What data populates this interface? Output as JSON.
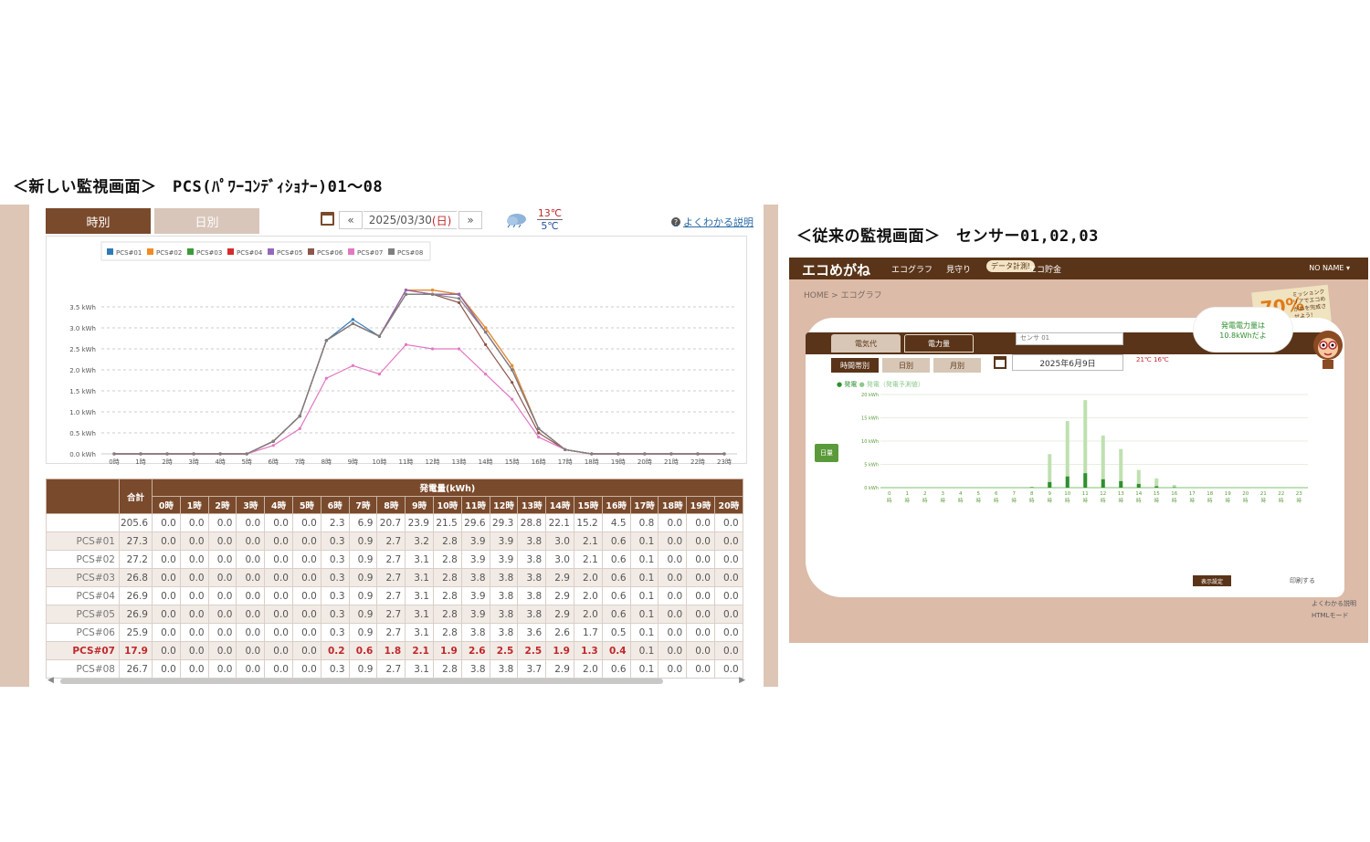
{
  "headings": {
    "new": "＜新しい監視画面＞　PCS(ﾊﾟﾜｰｺﾝﾃﾞｨｼｮﾅｰ)01～08",
    "old": "＜従来の監視画面＞　センサー01,02,03"
  },
  "new_screen": {
    "tabs": {
      "hourly": "時別",
      "daily": "日別"
    },
    "date_nav": {
      "prev": "«",
      "next": "»",
      "date": "2025/03/30",
      "dow": "(日)"
    },
    "weather": {
      "high": "13℃",
      "low": "5℃"
    },
    "help_link": "よくわかる説明",
    "table": {
      "header_total": "合計",
      "header_group": "発電量(kWh)",
      "hours": [
        "0時",
        "1時",
        "2時",
        "3時",
        "4時",
        "5時",
        "6時",
        "7時",
        "8時",
        "9時",
        "10時",
        "11時",
        "12時",
        "13時",
        "14時",
        "15時",
        "16時",
        "17時",
        "18時",
        "19時",
        "20時"
      ],
      "rows": [
        {
          "label": "",
          "total": "205.6",
          "values": [
            "0.0",
            "0.0",
            "0.0",
            "0.0",
            "0.0",
            "0.0",
            "2.3",
            "6.9",
            "20.7",
            "23.9",
            "21.5",
            "29.6",
            "29.3",
            "28.8",
            "22.1",
            "15.2",
            "4.5",
            "0.8",
            "0.0",
            "0.0",
            "0.0"
          ]
        },
        {
          "label": "PCS#01",
          "total": "27.3",
          "values": [
            "0.0",
            "0.0",
            "0.0",
            "0.0",
            "0.0",
            "0.0",
            "0.3",
            "0.9",
            "2.7",
            "3.2",
            "2.8",
            "3.9",
            "3.9",
            "3.8",
            "3.0",
            "2.1",
            "0.6",
            "0.1",
            "0.0",
            "0.0",
            "0.0"
          ]
        },
        {
          "label": "PCS#02",
          "total": "27.2",
          "values": [
            "0.0",
            "0.0",
            "0.0",
            "0.0",
            "0.0",
            "0.0",
            "0.3",
            "0.9",
            "2.7",
            "3.1",
            "2.8",
            "3.9",
            "3.9",
            "3.8",
            "3.0",
            "2.1",
            "0.6",
            "0.1",
            "0.0",
            "0.0",
            "0.0"
          ]
        },
        {
          "label": "PCS#03",
          "total": "26.8",
          "values": [
            "0.0",
            "0.0",
            "0.0",
            "0.0",
            "0.0",
            "0.0",
            "0.3",
            "0.9",
            "2.7",
            "3.1",
            "2.8",
            "3.8",
            "3.8",
            "3.8",
            "2.9",
            "2.0",
            "0.6",
            "0.1",
            "0.0",
            "0.0",
            "0.0"
          ]
        },
        {
          "label": "PCS#04",
          "total": "26.9",
          "values": [
            "0.0",
            "0.0",
            "0.0",
            "0.0",
            "0.0",
            "0.0",
            "0.3",
            "0.9",
            "2.7",
            "3.1",
            "2.8",
            "3.9",
            "3.8",
            "3.8",
            "2.9",
            "2.0",
            "0.6",
            "0.1",
            "0.0",
            "0.0",
            "0.0"
          ]
        },
        {
          "label": "PCS#05",
          "total": "26.9",
          "values": [
            "0.0",
            "0.0",
            "0.0",
            "0.0",
            "0.0",
            "0.0",
            "0.3",
            "0.9",
            "2.7",
            "3.1",
            "2.8",
            "3.9",
            "3.8",
            "3.8",
            "2.9",
            "2.0",
            "0.6",
            "0.1",
            "0.0",
            "0.0",
            "0.0"
          ]
        },
        {
          "label": "PCS#06",
          "total": "25.9",
          "values": [
            "0.0",
            "0.0",
            "0.0",
            "0.0",
            "0.0",
            "0.0",
            "0.3",
            "0.9",
            "2.7",
            "3.1",
            "2.8",
            "3.8",
            "3.8",
            "3.6",
            "2.6",
            "1.7",
            "0.5",
            "0.1",
            "0.0",
            "0.0",
            "0.0"
          ]
        },
        {
          "label": "PCS#07",
          "total": "17.9",
          "highlight": true,
          "values": [
            "0.0",
            "0.0",
            "0.0",
            "0.0",
            "0.0",
            "0.0",
            "0.2",
            "0.6",
            "1.8",
            "2.1",
            "1.9",
            "2.6",
            "2.5",
            "2.5",
            "1.9",
            "1.3",
            "0.4",
            "0.1",
            "0.0",
            "0.0",
            "0.0"
          ]
        },
        {
          "label": "PCS#08",
          "total": "26.7",
          "values": [
            "0.0",
            "0.0",
            "0.0",
            "0.0",
            "0.0",
            "0.0",
            "0.3",
            "0.9",
            "2.7",
            "3.1",
            "2.8",
            "3.8",
            "3.8",
            "3.7",
            "2.9",
            "2.0",
            "0.6",
            "0.1",
            "0.0",
            "0.0",
            "0.0"
          ]
        }
      ]
    }
  },
  "chart_data": [
    {
      "type": "line",
      "title": "",
      "xlabel": "",
      "ylabel": "",
      "x": [
        "0時",
        "1時",
        "2時",
        "3時",
        "4時",
        "5時",
        "6時",
        "7時",
        "8時",
        "9時",
        "10時",
        "11時",
        "12時",
        "13時",
        "14時",
        "15時",
        "16時",
        "17時",
        "18時",
        "19時",
        "20時",
        "21時",
        "22時",
        "23時"
      ],
      "y_ticks": [
        "0.0 kWh",
        "0.5 kWh",
        "1.0 kWh",
        "1.5 kWh",
        "2.0 kWh",
        "2.5 kWh",
        "3.0 kWh",
        "3.5 kWh"
      ],
      "ylim": [
        0,
        4
      ],
      "legend_position": "top-left",
      "series": [
        {
          "name": "PCS#01",
          "color": "#2e7bb8",
          "values": [
            0,
            0,
            0,
            0,
            0,
            0,
            0.3,
            0.9,
            2.7,
            3.2,
            2.8,
            3.9,
            3.9,
            3.8,
            3.0,
            2.1,
            0.6,
            0.1,
            0,
            0,
            0,
            0,
            0,
            0
          ]
        },
        {
          "name": "PCS#02",
          "color": "#f28b22",
          "values": [
            0,
            0,
            0,
            0,
            0,
            0,
            0.3,
            0.9,
            2.7,
            3.1,
            2.8,
            3.9,
            3.9,
            3.8,
            3.0,
            2.1,
            0.6,
            0.1,
            0,
            0,
            0,
            0,
            0,
            0
          ]
        },
        {
          "name": "PCS#03",
          "color": "#3a9b3a",
          "values": [
            0,
            0,
            0,
            0,
            0,
            0,
            0.3,
            0.9,
            2.7,
            3.1,
            2.8,
            3.8,
            3.8,
            3.8,
            2.9,
            2.0,
            0.6,
            0.1,
            0,
            0,
            0,
            0,
            0,
            0
          ]
        },
        {
          "name": "PCS#04",
          "color": "#d62b2b",
          "values": [
            0,
            0,
            0,
            0,
            0,
            0,
            0.3,
            0.9,
            2.7,
            3.1,
            2.8,
            3.9,
            3.8,
            3.8,
            2.9,
            2.0,
            0.6,
            0.1,
            0,
            0,
            0,
            0,
            0,
            0
          ]
        },
        {
          "name": "PCS#05",
          "color": "#9467bd",
          "values": [
            0,
            0,
            0,
            0,
            0,
            0,
            0.3,
            0.9,
            2.7,
            3.1,
            2.8,
            3.9,
            3.8,
            3.8,
            2.9,
            2.0,
            0.6,
            0.1,
            0,
            0,
            0,
            0,
            0,
            0
          ]
        },
        {
          "name": "PCS#06",
          "color": "#8c564b",
          "values": [
            0,
            0,
            0,
            0,
            0,
            0,
            0.3,
            0.9,
            2.7,
            3.1,
            2.8,
            3.8,
            3.8,
            3.6,
            2.6,
            1.7,
            0.5,
            0.1,
            0,
            0,
            0,
            0,
            0,
            0
          ]
        },
        {
          "name": "PCS#07",
          "color": "#e377c2",
          "values": [
            0,
            0,
            0,
            0,
            0,
            0,
            0.2,
            0.6,
            1.8,
            2.1,
            1.9,
            2.6,
            2.5,
            2.5,
            1.9,
            1.3,
            0.4,
            0.1,
            0,
            0,
            0,
            0,
            0,
            0
          ]
        },
        {
          "name": "PCS#08",
          "color": "#7f7f7f",
          "values": [
            0,
            0,
            0,
            0,
            0,
            0,
            0.3,
            0.9,
            2.7,
            3.1,
            2.8,
            3.8,
            3.8,
            3.7,
            2.9,
            2.0,
            0.6,
            0.1,
            0,
            0,
            0,
            0,
            0,
            0
          ]
        }
      ]
    },
    {
      "type": "bar",
      "title": "",
      "legend": [
        "発電",
        "発電（発電予測値）"
      ],
      "y_ticks": [
        "0 kWh",
        "5 kWh",
        "10 kWh",
        "15 kWh",
        "20 kWh"
      ],
      "ylim": [
        0,
        20
      ],
      "x": [
        "0",
        "1",
        "2",
        "3",
        "4",
        "5",
        "6",
        "7",
        "8",
        "9",
        "10",
        "11",
        "12",
        "13",
        "14",
        "15",
        "16",
        "17",
        "18",
        "19",
        "20",
        "21",
        "22",
        "23"
      ],
      "x_suffix": "時",
      "series": [
        {
          "name": "発電",
          "color": "#2f8f2f",
          "values": [
            0,
            0,
            0,
            0,
            0,
            0,
            0,
            0,
            0.1,
            1.2,
            2.4,
            3.1,
            1.8,
            1.4,
            0.8,
            0.3,
            0.1,
            0,
            0,
            0,
            0,
            0,
            0,
            0
          ]
        },
        {
          "name": "発電（発電予測値）",
          "color": "#bfe0b0",
          "values": [
            0,
            0,
            0,
            0,
            0,
            0,
            0,
            0,
            0.2,
            7.2,
            14.3,
            18.8,
            11.2,
            8.3,
            3.8,
            2.0,
            0.6,
            0,
            0,
            0,
            0,
            0,
            0,
            0
          ]
        }
      ]
    }
  ],
  "old_screen": {
    "logo": "エコめがね",
    "nav": {
      "graph": "エコグラフ",
      "watch": "見守り",
      "datalog": "データ計測!",
      "savings": "エコ貯金"
    },
    "user": "NO NAME ▾",
    "breadcrumb": "HOME > エコグラフ",
    "sticker": {
      "percent": "70%",
      "text": "ミッションクリアでエコめがねを完成させよう!"
    },
    "tabs": {
      "cost": "電気代",
      "power": "電力量"
    },
    "sensor_select": "センサ 01",
    "subtabs": {
      "hourly": "時間帯別",
      "daily": "日別",
      "monthly": "月別"
    },
    "date": "2025年6月9日",
    "weather": "21℃ 16℃",
    "bubble": "発電電力量は\n10.8kWhだよ",
    "side_button": "日量",
    "settings": "表示設定",
    "print": "印刷する",
    "help": "よくわかる説明",
    "html_mode": "HTMLモード"
  }
}
